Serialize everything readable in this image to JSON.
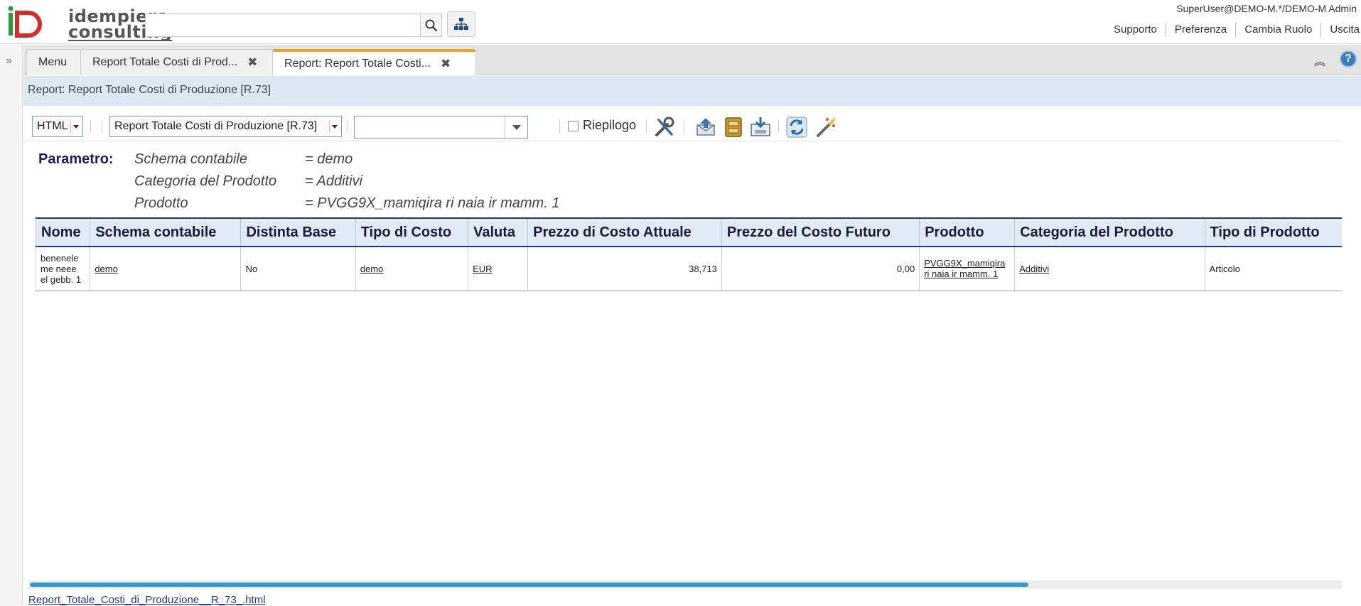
{
  "header": {
    "logo_line1": "idempiere",
    "logo_line2": "consulting",
    "user": "SuperUser@DEMO-M.*/DEMO-M Admin",
    "links": [
      "Supporto",
      "Preferenza",
      "Cambia Ruolo",
      "Uscita"
    ]
  },
  "tabs": [
    {
      "label": "Menu"
    },
    {
      "label": "Report Totale Costi di Prod...",
      "closable": true
    },
    {
      "label": "Report: Report Totale Costi...",
      "closable": true,
      "active": true
    }
  ],
  "title": "Report: Report Totale Costi di Produzione [R.73]",
  "toolbar": {
    "format": "HTML",
    "report": "Report Totale Costi di Produzione [R.73]",
    "print_format": "",
    "summary_label": "Riepilogo",
    "summary_checked": false
  },
  "params": {
    "label": "Parametro:",
    "rows": [
      {
        "name": "Schema contabile",
        "value": "= demo"
      },
      {
        "name": "Categoria del Prodotto",
        "value": "= Additivi"
      },
      {
        "name": "Prodotto",
        "value": "= PVGG9X_mamiqira ri naia ir mamm. 1"
      }
    ]
  },
  "table": {
    "headers": [
      "Nome",
      "Schema contabile",
      "Distinta Base",
      "Tipo di Costo",
      "Valuta",
      "Prezzo di Costo Attuale",
      "Prezzo del Costo Futuro",
      "Prodotto",
      "Categoria del Prodotto",
      "Tipo di Prodotto"
    ],
    "row": {
      "nome": "benenele me neee el gebb. 1",
      "schema": "demo",
      "distinta": "No",
      "tipo_costo": "demo",
      "valuta": "EUR",
      "prezzo_attuale": "38,713",
      "prezzo_futuro": "0,00",
      "prodotto": "PVGG9X_mamiqira ri naia ir mamm. 1",
      "categoria": "Additivi",
      "tipo_prodotto": "Articolo"
    }
  },
  "footer": {
    "file_link": "Report_Totale_Costi_di_Produzione__R_73_.html"
  },
  "colors": {
    "accent_tab": "#f2a321",
    "title_band": "#dde9f2",
    "scroll_thumb": "#2f9ad6"
  }
}
